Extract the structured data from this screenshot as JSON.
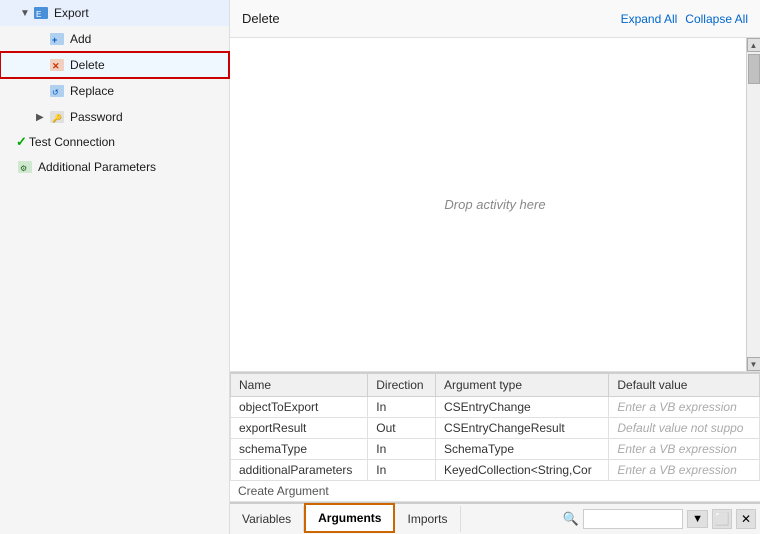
{
  "sidebar": {
    "items": [
      {
        "id": "export",
        "label": "Export",
        "indent": 0,
        "expander": "▼",
        "icon": "export-icon",
        "selected": false
      },
      {
        "id": "add",
        "label": "Add",
        "indent": 1,
        "expander": "",
        "icon": "add-icon",
        "selected": false
      },
      {
        "id": "delete",
        "label": "Delete",
        "indent": 1,
        "expander": "",
        "icon": "delete-icon",
        "selected": true
      },
      {
        "id": "replace",
        "label": "Replace",
        "indent": 1,
        "expander": "",
        "icon": "replace-icon",
        "selected": false
      },
      {
        "id": "password",
        "label": "Password",
        "indent": 1,
        "expander": "▶",
        "icon": "password-icon",
        "selected": false
      },
      {
        "id": "testconnection",
        "label": "Test Connection",
        "indent": 0,
        "expander": "",
        "icon": "testconn-icon",
        "selected": false
      },
      {
        "id": "additionalparams",
        "label": "Additional Parameters",
        "indent": 0,
        "expander": "",
        "icon": "params-icon",
        "selected": false
      }
    ]
  },
  "content": {
    "header_title": "Delete",
    "expand_all": "Expand All",
    "collapse_all": "Collapse All",
    "drop_text": "Drop activity here"
  },
  "args_table": {
    "columns": [
      "Name",
      "Direction",
      "Argument type",
      "Default value"
    ],
    "rows": [
      {
        "name": "objectToExport",
        "direction": "In",
        "type": "CSEntryChange",
        "default": "Enter a VB expression",
        "default_placeholder": true
      },
      {
        "name": "exportResult",
        "direction": "Out",
        "type": "CSEntryChangeResult",
        "default": "Default value not suppo",
        "default_placeholder": true
      },
      {
        "name": "schemaType",
        "direction": "In",
        "type": "SchemaType",
        "default": "Enter a VB expression",
        "default_placeholder": true
      },
      {
        "name": "additionalParameters",
        "direction": "In",
        "type": "KeyedCollection<String,Cor",
        "default": "Enter a VB expression",
        "default_placeholder": true
      }
    ],
    "create_argument_label": "Create Argument"
  },
  "bottom_tabs": {
    "tabs": [
      {
        "id": "variables",
        "label": "Variables",
        "active": false
      },
      {
        "id": "arguments",
        "label": "Arguments",
        "active": true
      },
      {
        "id": "imports",
        "label": "Imports",
        "active": false
      }
    ],
    "search_placeholder": ""
  }
}
